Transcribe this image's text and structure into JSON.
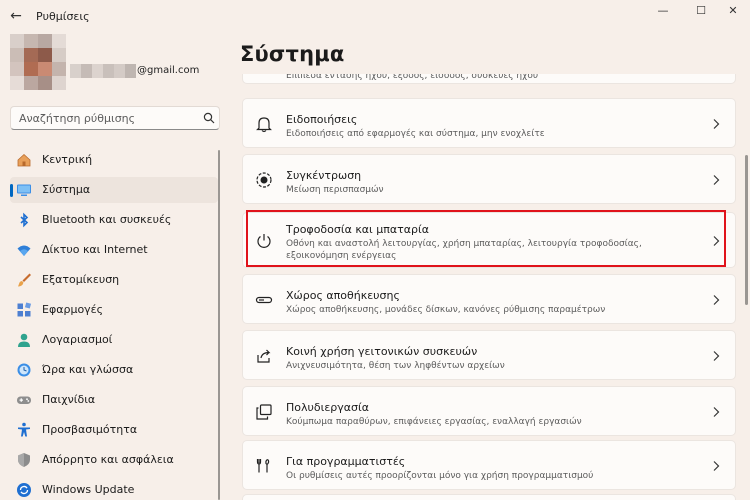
{
  "window": {
    "title": "Ρυθμίσεις",
    "back_glyph": "←",
    "minimize_glyph": "—",
    "maximize_glyph": "☐",
    "close_glyph": "✕"
  },
  "account": {
    "email": "@gmail.com"
  },
  "search": {
    "placeholder": "Αναζήτηση ρύθμισης"
  },
  "sidebar": {
    "items": [
      {
        "label": "Κεντρική",
        "icon": "home-icon"
      },
      {
        "label": "Σύστημα",
        "icon": "monitor-icon",
        "active": true
      },
      {
        "label": "Bluetooth και συσκευές",
        "icon": "bluetooth-icon"
      },
      {
        "label": "Δίκτυο και Internet",
        "icon": "wifi-icon"
      },
      {
        "label": "Εξατομίκευση",
        "icon": "brush-icon"
      },
      {
        "label": "Εφαρμογές",
        "icon": "apps-icon"
      },
      {
        "label": "Λογαριασμοί",
        "icon": "person-icon"
      },
      {
        "label": "Ώρα και γλώσσα",
        "icon": "globe-clock-icon"
      },
      {
        "label": "Παιχνίδια",
        "icon": "gamepad-icon"
      },
      {
        "label": "Προσβασιμότητα",
        "icon": "accessibility-icon"
      },
      {
        "label": "Απόρρητο και ασφάλεια",
        "icon": "shield-icon"
      },
      {
        "label": "Windows Update",
        "icon": "update-icon"
      }
    ]
  },
  "main": {
    "title": "Σύστημα",
    "partial_top_text": "Επίπεδα έντασης ήχου, έξοδος, είσοδος, συσκευές ήχου",
    "cards": [
      {
        "title": "Ειδοποιήσεις",
        "subtitle": "Ειδοποιήσεις από εφαρμογές και σύστημα, μην ενοχλείτε",
        "icon": "bell-icon"
      },
      {
        "title": "Συγκέντρωση",
        "subtitle": "Μείωση περισπασμών",
        "icon": "focus-icon"
      },
      {
        "title": "Τροφοδοσία και μπαταρία",
        "subtitle": "Οθόνη και αναστολή λειτουργίας, χρήση μπαταρίας, λειτουργία τροφοδοσίας, εξοικονόμηση ενέργειας",
        "icon": "power-icon",
        "highlighted": true
      },
      {
        "title": "Χώρος αποθήκευσης",
        "subtitle": "Χώρος αποθήκευσης, μονάδες δίσκων, κανόνες ρύθμισης παραμέτρων",
        "icon": "storage-icon"
      },
      {
        "title": "Κοινή χρήση γειτονικών συσκευών",
        "subtitle": "Ανιχνευσιμότητα, θέση των ληφθέντων αρχείων",
        "icon": "share-icon"
      },
      {
        "title": "Πολυδιεργασία",
        "subtitle": "Κούμπωμα παραθύρων, επιφάνειες εργασίας, εναλλαγή εργασιών",
        "icon": "multitask-icon"
      },
      {
        "title": "Για προγραμματιστές",
        "subtitle": "Οι ρυθμίσεις αυτές προορίζονται μόνο για χρήση προγραμματισμού",
        "icon": "developer-icon"
      }
    ]
  },
  "colors": {
    "accent": "#0067c0",
    "highlight_border": "#e0131b",
    "background": "#f7efe9",
    "card": "#fdfbf9"
  }
}
